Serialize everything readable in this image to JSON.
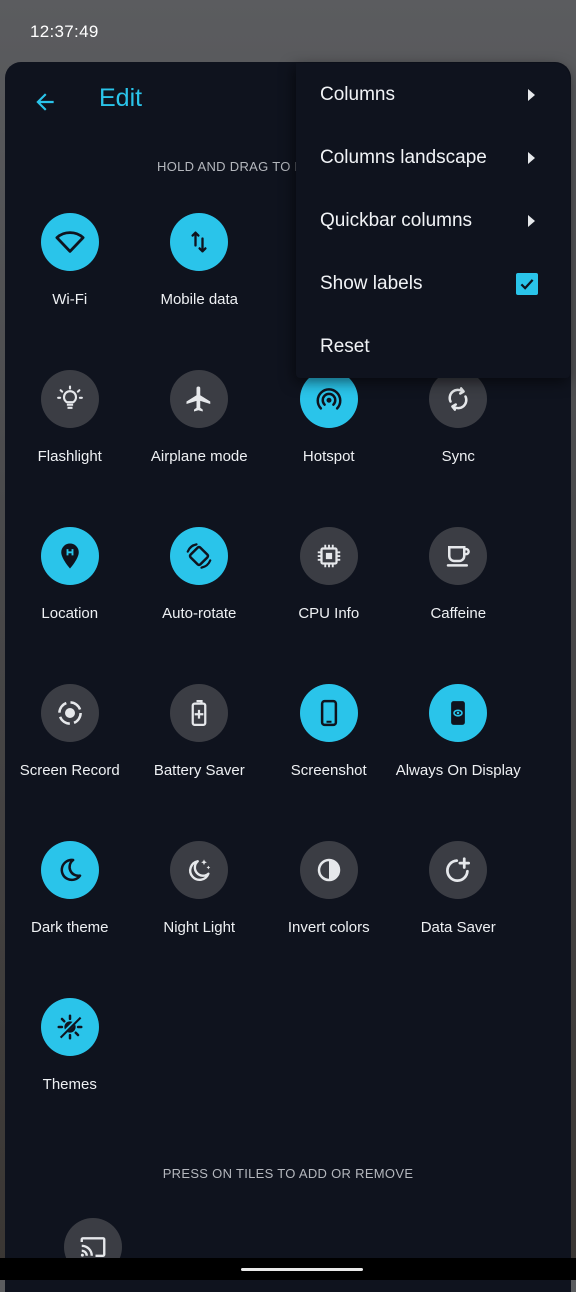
{
  "status": {
    "time": "12:37:49"
  },
  "header": {
    "title": "Edit"
  },
  "hints": {
    "top": "HOLD AND DRAG TO REARRANGE TILES",
    "bottom": "PRESS ON TILES TO ADD OR REMOVE"
  },
  "tiles": [
    {
      "label": "Wi-Fi",
      "icon": "wifi-icon",
      "active": true
    },
    {
      "label": "Mobile data",
      "icon": "mobile-data-icon",
      "active": true
    },
    {
      "label": "",
      "icon": "",
      "active": false
    },
    {
      "label": "",
      "icon": "",
      "active": false
    },
    {
      "label": "Flashlight",
      "icon": "flashlight-icon",
      "active": false
    },
    {
      "label": "Airplane mode",
      "icon": "airplane-icon",
      "active": false
    },
    {
      "label": "Hotspot",
      "icon": "hotspot-icon",
      "active": true
    },
    {
      "label": "Sync",
      "icon": "sync-icon",
      "active": false
    },
    {
      "label": "Location",
      "icon": "location-icon",
      "active": true
    },
    {
      "label": "Auto-rotate",
      "icon": "auto-rotate-icon",
      "active": true
    },
    {
      "label": "CPU Info",
      "icon": "cpu-icon",
      "active": false
    },
    {
      "label": "Caffeine",
      "icon": "coffee-icon",
      "active": false
    },
    {
      "label": "Screen Record",
      "icon": "screen-record-icon",
      "active": false
    },
    {
      "label": "Battery Saver",
      "icon": "battery-saver-icon",
      "active": false
    },
    {
      "label": "Screenshot",
      "icon": "screenshot-icon",
      "active": true
    },
    {
      "label": "Always On Display",
      "icon": "always-on-display-icon",
      "active": true
    },
    {
      "label": "Dark theme",
      "icon": "dark-theme-icon",
      "active": true
    },
    {
      "label": "Night Light",
      "icon": "night-light-icon",
      "active": false
    },
    {
      "label": "Invert colors",
      "icon": "invert-colors-icon",
      "active": false
    },
    {
      "label": "Data Saver",
      "icon": "data-saver-icon",
      "active": false
    },
    {
      "label": "Themes",
      "icon": "themes-icon",
      "active": true
    }
  ],
  "available_tiles": [
    {
      "label": "",
      "icon": "cast-icon",
      "active": false
    }
  ],
  "menu": {
    "items": [
      {
        "label": "Columns",
        "type": "submenu"
      },
      {
        "label": "Columns landscape",
        "type": "submenu"
      },
      {
        "label": "Quickbar columns",
        "type": "submenu"
      },
      {
        "label": "Show labels",
        "type": "checkbox",
        "checked": true
      },
      {
        "label": "Reset",
        "type": "action"
      }
    ]
  },
  "colors": {
    "accent": "#2ac4ea",
    "panel": "#0f131e",
    "tile_off": "#3b3d44"
  }
}
